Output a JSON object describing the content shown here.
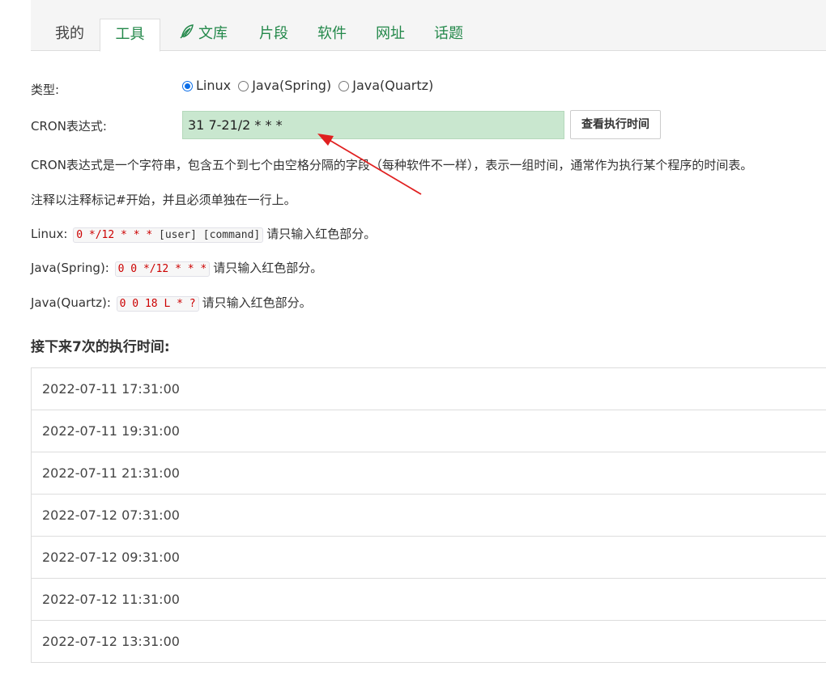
{
  "tabs": [
    {
      "label": "我的"
    },
    {
      "label": "工具"
    },
    {
      "label": "文库"
    },
    {
      "label": "片段"
    },
    {
      "label": "软件"
    },
    {
      "label": "网址"
    },
    {
      "label": "话题"
    }
  ],
  "form": {
    "type_label": "类型:",
    "radios": [
      {
        "label": "Linux",
        "checked": true
      },
      {
        "label": "Java(Spring)",
        "checked": false
      },
      {
        "label": "Java(Quartz)",
        "checked": false
      }
    ],
    "cron_label": "CRON表达式:",
    "cron_value": "31 7-21/2 * * *",
    "query_button": "查看执行时间"
  },
  "description": {
    "line1": "CRON表达式是一个字符串，包含五个到七个由空格分隔的字段（每种软件不一样），表示一组时间，通常作为执行某个程序的时间表。",
    "line2": "注释以注释标记#开始，并且必须单独在一行上。",
    "examples": [
      {
        "prefix": "Linux:",
        "red": "0 */12 * * *",
        "rest": " [user] [command]",
        "suffix": "请只输入红色部分。"
      },
      {
        "prefix": "Java(Spring):",
        "red": "0 0 */12 * * *",
        "rest": "",
        "suffix": "请只输入红色部分。"
      },
      {
        "prefix": "Java(Quartz):",
        "red": "0 0 18 L * ?",
        "rest": "",
        "suffix": "请只输入红色部分。"
      }
    ]
  },
  "results": {
    "title": "接下来7次的执行时间:",
    "times": [
      "2022-07-11 17:31:00",
      "2022-07-11 19:31:00",
      "2022-07-11 21:31:00",
      "2022-07-12 07:31:00",
      "2022-07-12 09:31:00",
      "2022-07-12 11:31:00",
      "2022-07-12 13:31:00"
    ]
  },
  "icons": {
    "quill": "quill-icon",
    "arrow": "red-arrow-annotation"
  },
  "colors": {
    "accent_green": "#23884a",
    "input_bg": "#c9e7cf",
    "example_red": "#cc0000",
    "annotation_red": "#e02020"
  }
}
